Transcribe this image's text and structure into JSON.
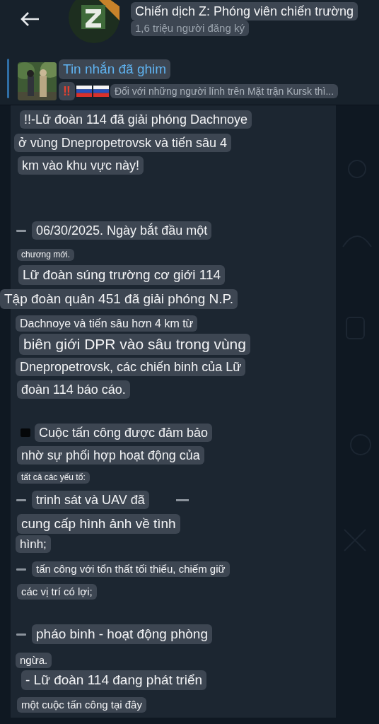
{
  "header": {
    "title": "Chiến dịch Z: Phóng viên chiến trường",
    "subtitle": "1,6 triệu người đăng ký"
  },
  "pinned": {
    "label": "Tin nhắn đã ghim",
    "emoji": "‼",
    "preview": "Đối với những người lính trên Mặt trận Kursk thì..."
  },
  "message": {
    "lines": [
      {
        "text": "!!-Lữ đoàn 114 đã giải phóng Dachnoye"
      },
      {
        "text": "ở vùng Dnepropetrovsk và tiến sâu 4"
      },
      {
        "text": "km vào khu vực này!"
      },
      {
        "text": "06/30/2025. Ngày bắt đầu một",
        "dash_before": true
      },
      {
        "text": "chương mới."
      },
      {
        "text": "Lữ đoàn súng trường cơ giới 114"
      },
      {
        "text": "Tập đoàn quân 451 đã giải phóng N.P."
      },
      {
        "text": "Dachnoye và tiến sâu hơn 4 km từ"
      },
      {
        "text": "biên giới DPR vào sâu trong vùng"
      },
      {
        "text": "Dnepropetrovsk, các chiến binh của Lữ"
      },
      {
        "text": "đoàn 114 báo cáo."
      },
      {
        "text": "Cuộc tấn công được đảm bảo",
        "square_before": true
      },
      {
        "text": "nhờ sự phối hợp hoạt động của"
      },
      {
        "text": "tất cả các yếu tố:"
      },
      {
        "text": "trinh sát và UAV đã",
        "dash_before": true,
        "dash_after": true
      },
      {
        "text": "cung cấp hình ảnh về tình"
      },
      {
        "text": "hình;"
      },
      {
        "text": "tấn công với tổn thất tối thiểu, chiếm giữ",
        "dash_before": true
      },
      {
        "text": "các vị trí có lợi;"
      },
      {
        "text": "pháo binh - hoạt động phòng",
        "dash_before": true
      },
      {
        "text": "ngừa."
      },
      {
        "text": "- Lữ đoàn 114 đang phát triển"
      },
      {
        "text": "một cuộc tấn công tại đây"
      }
    ]
  }
}
